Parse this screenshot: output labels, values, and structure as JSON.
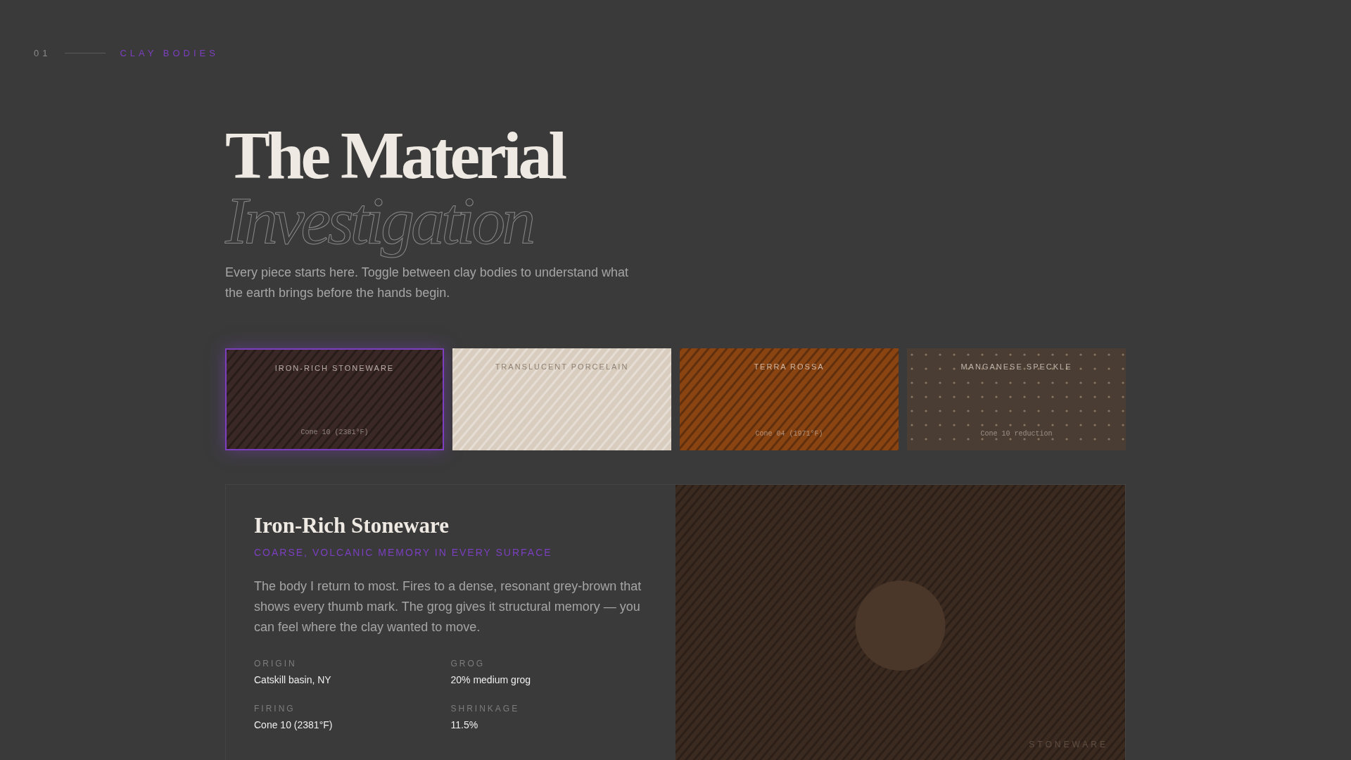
{
  "section": {
    "number": "01",
    "label": "CLAY BODIES"
  },
  "hero": {
    "title": "The Material",
    "subtitle": "Investigation",
    "intro": "Every piece starts here. Toggle between clay bodies to understand what the earth brings before the hands begin."
  },
  "clays": [
    {
      "name": "IRON-RICH STONEWARE",
      "firing": "Cone 10 (2381°F)",
      "kind": "stripes",
      "color": "#3a2826",
      "selected": true
    },
    {
      "name": "TRANSLUCENT PORCELAIN",
      "kind": "stripes",
      "color": "#d8cdbf",
      "selected": false
    },
    {
      "name": "TERRA ROSSA",
      "firing": "Cone 04 (1971°F)",
      "kind": "stripes",
      "color": "#8a4412",
      "selected": false
    },
    {
      "name": "MANGANESE SPECKLE",
      "firing": "Cone 10 reduction",
      "kind": "dots",
      "color": "#4a3e34",
      "selected": false
    }
  ],
  "detail": {
    "title": "Iron-Rich Stoneware",
    "tagline": "COARSE, VOLCANIC MEMORY IN EVERY SURFACE",
    "body": "The body I return to most. Fires to a dense, resonant grey-brown that shows every thumb mark. The grog gives it structural memory — you can feel where the clay wanted to move.",
    "specs": [
      {
        "label": "ORIGIN",
        "value": "Catskill basin, NY"
      },
      {
        "label": "GROG",
        "value": "20% medium grog"
      },
      {
        "label": "FIRING",
        "value": "Cone 10 (2381°F)"
      },
      {
        "label": "SHRINKAGE",
        "value": "11.5%"
      }
    ],
    "preview_label": "STONEWARE"
  }
}
